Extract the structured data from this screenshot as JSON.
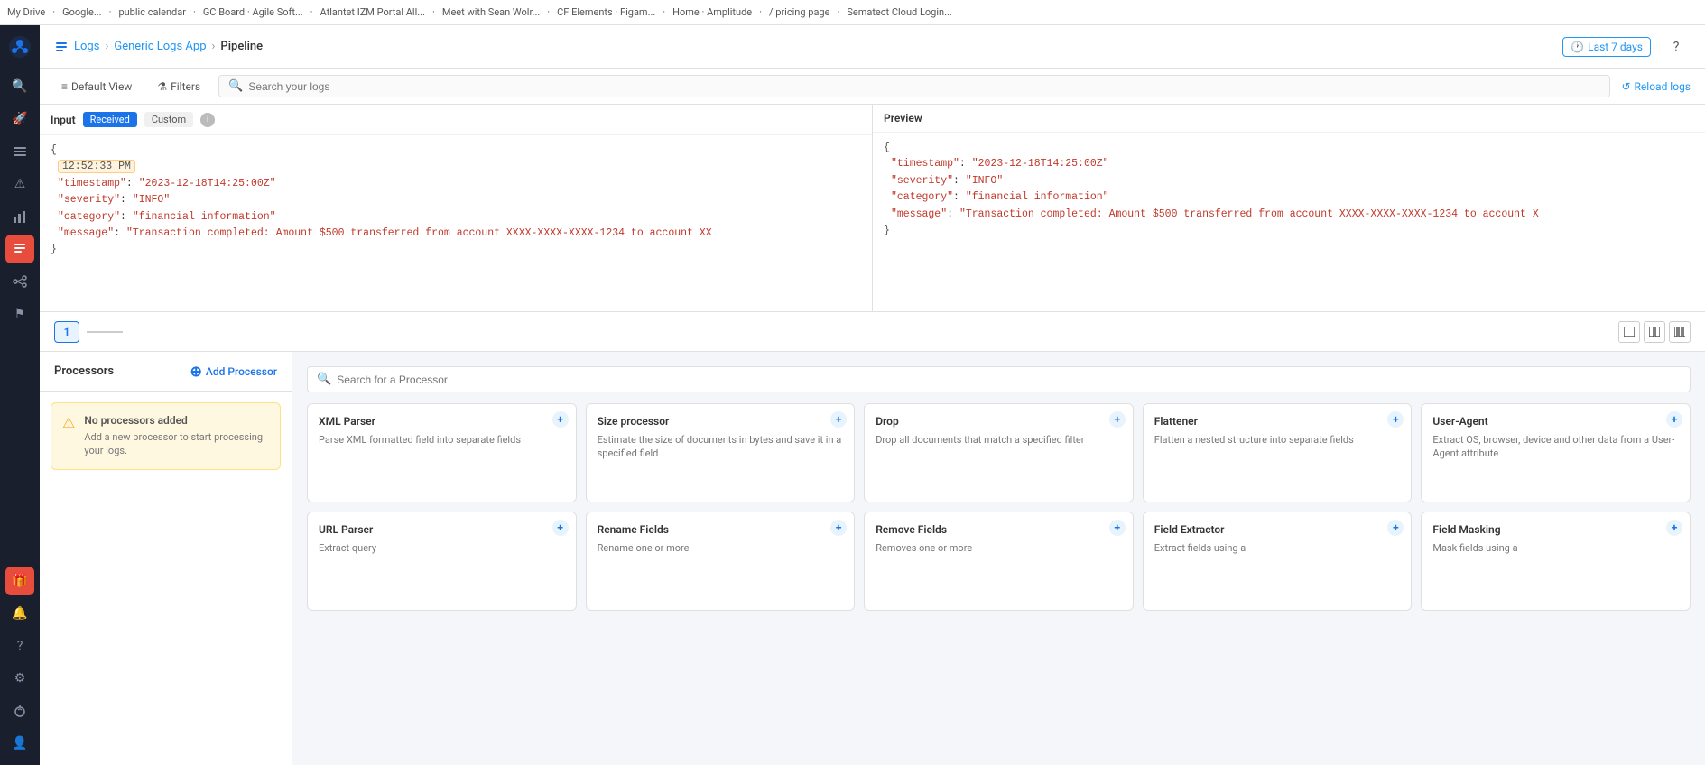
{
  "topnav": {
    "items": [
      "My Drive",
      "Google...",
      "public calendar",
      "GC Board · Agile Soft...",
      "Atlantet IZM Portal All...",
      "Meet with Sean Wolr...",
      "CF Elements · Figam...",
      "Home · Amplitude",
      "/ pricing page",
      "Sematect Cloud Login..."
    ]
  },
  "breadcrumb": {
    "logs": "Logs",
    "app": "Generic Logs App",
    "current": "Pipeline"
  },
  "header": {
    "time_range": "Last 7 days",
    "help_label": "?"
  },
  "toolbar": {
    "default_view_label": "Default View",
    "filters_label": "Filters",
    "search_placeholder": "Search your logs",
    "reload_label": "Reload logs"
  },
  "input": {
    "title": "Input",
    "tab_received": "Received",
    "tab_custom": "Custom",
    "timestamp_value": "12:52:33 PM",
    "code_lines": [
      "{",
      "  \"timestamp\": \"2023-12-18T14:25:00Z\"",
      "  \"severity\": \"INFO\"",
      "  \"category\": \"financial information\"",
      "  \"message\": \"Transaction completed: Amount $500 transferred from account XXXX-XXXX-XXXX-1234 to account XX",
      "}"
    ]
  },
  "preview": {
    "title": "Preview",
    "code_lines": [
      "{",
      "  \"timestamp\": \"2023-12-18T14:25:00Z\"",
      "  \"severity\": \"INFO\"",
      "  \"category\": \"financial information\"",
      "  \"message\": \"Transaction completed: Amount $500 transferred from account XXXX-XXXX-XXXX-1234 to account X",
      "}"
    ]
  },
  "pipeline": {
    "step_number": "1",
    "divider_label": "—"
  },
  "processors": {
    "title": "Processors",
    "add_label": "Add Processor",
    "empty_title": "No processors added",
    "empty_text": "Add a new processor to start processing your logs.",
    "search_placeholder": "Search for a Processor",
    "cards": [
      {
        "id": "xml-parser",
        "title": "XML Parser",
        "desc": "Parse XML formatted field into separate fields"
      },
      {
        "id": "size-processor",
        "title": "Size processor",
        "desc": "Estimate the size of documents in bytes and save it in a specified field"
      },
      {
        "id": "drop",
        "title": "Drop",
        "desc": "Drop all documents that match a specified filter"
      },
      {
        "id": "flattener",
        "title": "Flattener",
        "desc": "Flatten a nested structure into separate fields"
      },
      {
        "id": "user-agent",
        "title": "User-Agent",
        "desc": "Extract OS, browser, device and other data from a User-Agent attribute"
      },
      {
        "id": "url-parser",
        "title": "URL Parser",
        "desc": "Extract query"
      },
      {
        "id": "rename-fields",
        "title": "Rename Fields",
        "desc": "Rename one or more"
      },
      {
        "id": "remove-fields",
        "title": "Remove Fields",
        "desc": "Removes one or more"
      },
      {
        "id": "field-extractor",
        "title": "Field Extractor",
        "desc": "Extract fields using a"
      },
      {
        "id": "field-masking",
        "title": "Field Masking",
        "desc": "Mask fields using a"
      }
    ]
  },
  "icons": {
    "logo": "🐙",
    "search": "🔍",
    "alert": "🔔",
    "grid": "⊞",
    "info": "ℹ",
    "layers": "◫",
    "flag": "⚑",
    "gift": "🎁",
    "bell": "🔔",
    "question": "?",
    "settings": "⚙",
    "bug": "🐞",
    "user": "👤",
    "clock": "🕐",
    "refresh": "↺",
    "plus": "+",
    "warning": "⚠",
    "hamburger": "≡",
    "filter": "⚗"
  }
}
